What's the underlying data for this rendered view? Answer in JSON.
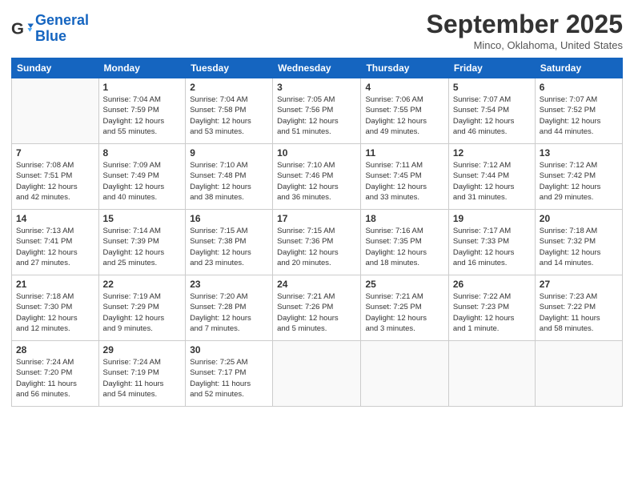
{
  "logo": {
    "line1": "General",
    "line2": "Blue"
  },
  "title": "September 2025",
  "location": "Minco, Oklahoma, United States",
  "days_of_week": [
    "Sunday",
    "Monday",
    "Tuesday",
    "Wednesday",
    "Thursday",
    "Friday",
    "Saturday"
  ],
  "weeks": [
    [
      {
        "day": "",
        "info": ""
      },
      {
        "day": "1",
        "info": "Sunrise: 7:04 AM\nSunset: 7:59 PM\nDaylight: 12 hours\nand 55 minutes."
      },
      {
        "day": "2",
        "info": "Sunrise: 7:04 AM\nSunset: 7:58 PM\nDaylight: 12 hours\nand 53 minutes."
      },
      {
        "day": "3",
        "info": "Sunrise: 7:05 AM\nSunset: 7:56 PM\nDaylight: 12 hours\nand 51 minutes."
      },
      {
        "day": "4",
        "info": "Sunrise: 7:06 AM\nSunset: 7:55 PM\nDaylight: 12 hours\nand 49 minutes."
      },
      {
        "day": "5",
        "info": "Sunrise: 7:07 AM\nSunset: 7:54 PM\nDaylight: 12 hours\nand 46 minutes."
      },
      {
        "day": "6",
        "info": "Sunrise: 7:07 AM\nSunset: 7:52 PM\nDaylight: 12 hours\nand 44 minutes."
      }
    ],
    [
      {
        "day": "7",
        "info": "Sunrise: 7:08 AM\nSunset: 7:51 PM\nDaylight: 12 hours\nand 42 minutes."
      },
      {
        "day": "8",
        "info": "Sunrise: 7:09 AM\nSunset: 7:49 PM\nDaylight: 12 hours\nand 40 minutes."
      },
      {
        "day": "9",
        "info": "Sunrise: 7:10 AM\nSunset: 7:48 PM\nDaylight: 12 hours\nand 38 minutes."
      },
      {
        "day": "10",
        "info": "Sunrise: 7:10 AM\nSunset: 7:46 PM\nDaylight: 12 hours\nand 36 minutes."
      },
      {
        "day": "11",
        "info": "Sunrise: 7:11 AM\nSunset: 7:45 PM\nDaylight: 12 hours\nand 33 minutes."
      },
      {
        "day": "12",
        "info": "Sunrise: 7:12 AM\nSunset: 7:44 PM\nDaylight: 12 hours\nand 31 minutes."
      },
      {
        "day": "13",
        "info": "Sunrise: 7:12 AM\nSunset: 7:42 PM\nDaylight: 12 hours\nand 29 minutes."
      }
    ],
    [
      {
        "day": "14",
        "info": "Sunrise: 7:13 AM\nSunset: 7:41 PM\nDaylight: 12 hours\nand 27 minutes."
      },
      {
        "day": "15",
        "info": "Sunrise: 7:14 AM\nSunset: 7:39 PM\nDaylight: 12 hours\nand 25 minutes."
      },
      {
        "day": "16",
        "info": "Sunrise: 7:15 AM\nSunset: 7:38 PM\nDaylight: 12 hours\nand 23 minutes."
      },
      {
        "day": "17",
        "info": "Sunrise: 7:15 AM\nSunset: 7:36 PM\nDaylight: 12 hours\nand 20 minutes."
      },
      {
        "day": "18",
        "info": "Sunrise: 7:16 AM\nSunset: 7:35 PM\nDaylight: 12 hours\nand 18 minutes."
      },
      {
        "day": "19",
        "info": "Sunrise: 7:17 AM\nSunset: 7:33 PM\nDaylight: 12 hours\nand 16 minutes."
      },
      {
        "day": "20",
        "info": "Sunrise: 7:18 AM\nSunset: 7:32 PM\nDaylight: 12 hours\nand 14 minutes."
      }
    ],
    [
      {
        "day": "21",
        "info": "Sunrise: 7:18 AM\nSunset: 7:30 PM\nDaylight: 12 hours\nand 12 minutes."
      },
      {
        "day": "22",
        "info": "Sunrise: 7:19 AM\nSunset: 7:29 PM\nDaylight: 12 hours\nand 9 minutes."
      },
      {
        "day": "23",
        "info": "Sunrise: 7:20 AM\nSunset: 7:28 PM\nDaylight: 12 hours\nand 7 minutes."
      },
      {
        "day": "24",
        "info": "Sunrise: 7:21 AM\nSunset: 7:26 PM\nDaylight: 12 hours\nand 5 minutes."
      },
      {
        "day": "25",
        "info": "Sunrise: 7:21 AM\nSunset: 7:25 PM\nDaylight: 12 hours\nand 3 minutes."
      },
      {
        "day": "26",
        "info": "Sunrise: 7:22 AM\nSunset: 7:23 PM\nDaylight: 12 hours\nand 1 minute."
      },
      {
        "day": "27",
        "info": "Sunrise: 7:23 AM\nSunset: 7:22 PM\nDaylight: 11 hours\nand 58 minutes."
      }
    ],
    [
      {
        "day": "28",
        "info": "Sunrise: 7:24 AM\nSunset: 7:20 PM\nDaylight: 11 hours\nand 56 minutes."
      },
      {
        "day": "29",
        "info": "Sunrise: 7:24 AM\nSunset: 7:19 PM\nDaylight: 11 hours\nand 54 minutes."
      },
      {
        "day": "30",
        "info": "Sunrise: 7:25 AM\nSunset: 7:17 PM\nDaylight: 11 hours\nand 52 minutes."
      },
      {
        "day": "",
        "info": ""
      },
      {
        "day": "",
        "info": ""
      },
      {
        "day": "",
        "info": ""
      },
      {
        "day": "",
        "info": ""
      }
    ]
  ]
}
